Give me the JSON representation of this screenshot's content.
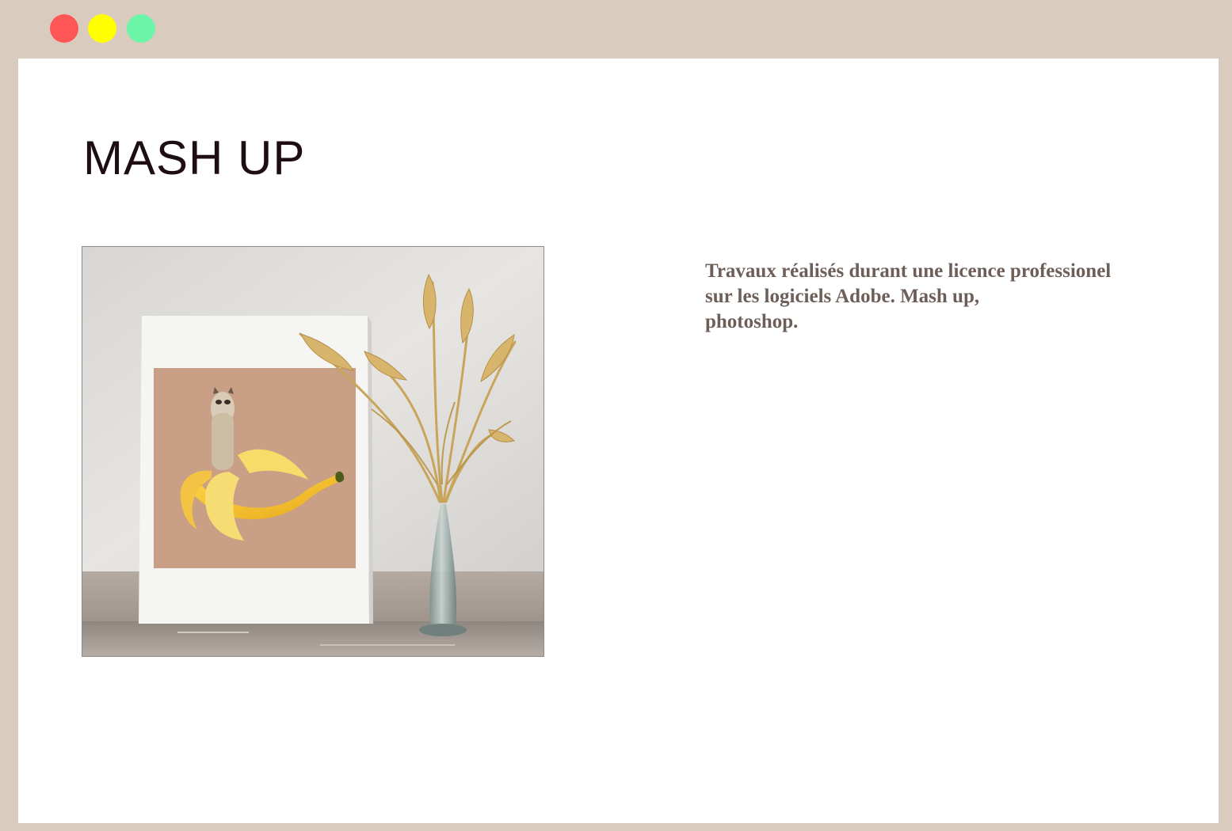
{
  "window": {
    "controls": [
      {
        "name": "close",
        "color": "#ff5757"
      },
      {
        "name": "minimize",
        "color": "#ffff00"
      },
      {
        "name": "maximize",
        "color": "#6cf5a8"
      }
    ]
  },
  "page": {
    "title": "MASH UP",
    "description": "Travaux réalisés durant une licence professionel\n sur les logiciels Adobe. Mash up,\nphotoshop.",
    "image": {
      "icon": "alpaca-banana-mashup-photo"
    }
  },
  "colors": {
    "frame": "#d9cbbd",
    "title": "#1e0e12",
    "text": "#6d5f58",
    "print_background": "#c99f85"
  }
}
